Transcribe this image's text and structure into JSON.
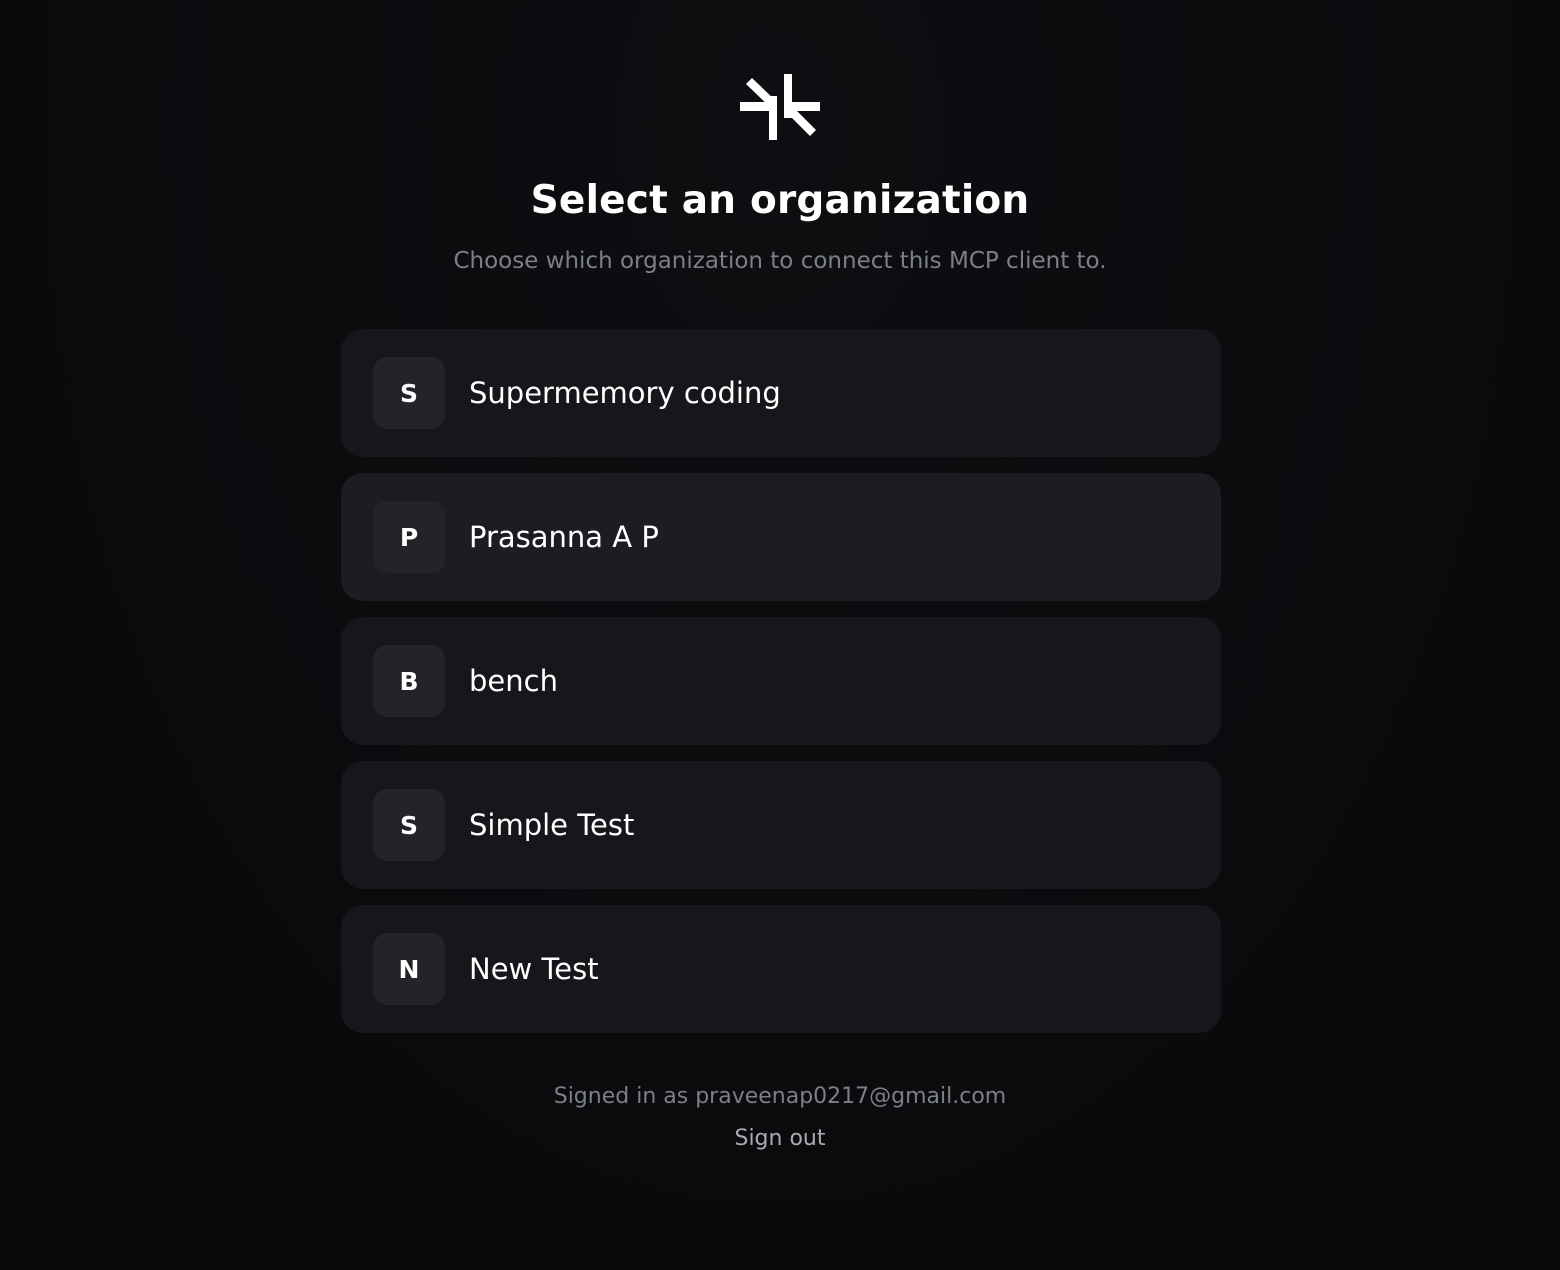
{
  "brand": {
    "logo_icon": "supermemory-logo-icon"
  },
  "header": {
    "title": "Select an organization",
    "subtitle": "Choose which organization to connect this MCP client to."
  },
  "organizations": [
    {
      "initial": "S",
      "name": "Supermemory coding"
    },
    {
      "initial": "P",
      "name": "Prasanna A P"
    },
    {
      "initial": "B",
      "name": "bench"
    },
    {
      "initial": "S",
      "name": "Simple Test"
    },
    {
      "initial": "N",
      "name": "New Test"
    }
  ],
  "footer": {
    "signed_in_text": "Signed in as praveenap0217@gmail.com",
    "sign_out_label": "Sign out"
  },
  "colors": {
    "background": "#0a0b0d",
    "card": "#16171b",
    "card_hover": "#1c1d22",
    "avatar": "#23242a",
    "muted_text": "#7d7f86"
  }
}
